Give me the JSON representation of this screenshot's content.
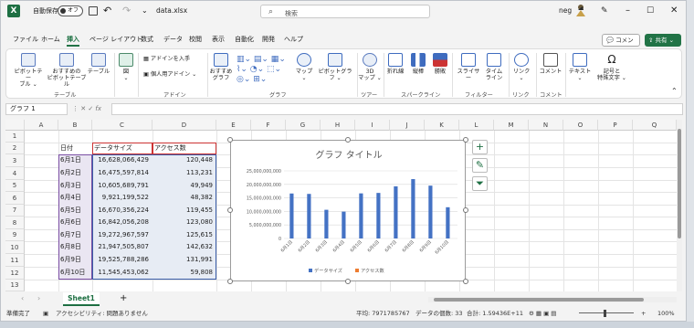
{
  "titlebar": {
    "autosave_label": "自動保存",
    "autosave_state": "オフ",
    "doc_title": "data.xlsx",
    "qat_more": "⌄",
    "search_placeholder": "検索",
    "user_name": "neg",
    "accent_color": "#217346"
  },
  "tabs": [
    "ファイル",
    "ホーム",
    "挿入",
    "ページ レイアウト",
    "数式",
    "データ",
    "校閲",
    "表示",
    "自動化",
    "開発",
    "ヘルプ"
  ],
  "active_tab": "挿入",
  "comment_button": "コメント",
  "share_button": "共有",
  "ribbon": {
    "pivot_table": "ピボットテー\nブル ⌄",
    "recommended_pivot": "おすすめの\nピボットテーブル",
    "table": "テーブル",
    "group_table": "テーブル",
    "figure": "図",
    "figure_more": "⌄",
    "get_addins": "アドインを入手",
    "my_addins": "個人用アドイン",
    "group_addins": "アドイン",
    "recommended_charts": "おすすめ\nグラフ",
    "map": "マップ",
    "pivot_chart": "ピボットグラフ",
    "group_chart": "グラフ",
    "map3d": "3D\nマップ ⌄",
    "group_tour": "ツアー",
    "line": "折れ線",
    "column": "縦棒",
    "winloss": "勝敗",
    "group_sparkline": "スパークライン",
    "slicer": "スライサー",
    "timeline": "タイム\nライン",
    "group_filter": "フィルター",
    "link": "リンク",
    "group_link": "リンク",
    "comment": "コメント",
    "group_comment": "コメント",
    "text": "テキスト",
    "symbol": "記号と\n特殊文字 ⌄"
  },
  "formula": {
    "name_box": "グラフ 1",
    "fx": "fx",
    "value": ""
  },
  "columns": [
    "A",
    "B",
    "C",
    "D",
    "E",
    "F",
    "G",
    "H",
    "I",
    "J",
    "K",
    "L",
    "M",
    "N",
    "O",
    "P",
    "Q"
  ],
  "rows": [
    "1",
    "2",
    "3",
    "4",
    "5",
    "6",
    "7",
    "8",
    "9",
    "10",
    "11",
    "12",
    "13"
  ],
  "table": {
    "header": [
      "日付",
      "データサイズ",
      "アクセス数"
    ],
    "rows": [
      [
        "6月1日",
        "16,628,066,429",
        "120,448"
      ],
      [
        "6月2日",
        "16,475,597,814",
        "113,231"
      ],
      [
        "6月3日",
        "10,605,689,791",
        "49,949"
      ],
      [
        "6月4日",
        "9,921,199,522",
        "48,382"
      ],
      [
        "6月5日",
        "16,670,356,224",
        "119,455"
      ],
      [
        "6月6日",
        "16,842,056,208",
        "123,080"
      ],
      [
        "6月7日",
        "19,272,967,597",
        "125,615"
      ],
      [
        "6月8日",
        "21,947,505,807",
        "142,632"
      ],
      [
        "6月9日",
        "19,525,788,286",
        "131,991"
      ],
      [
        "6月10日",
        "11,545,453,062",
        "59,808"
      ]
    ]
  },
  "chart_data": {
    "type": "bar",
    "title": "グラフ タイトル",
    "categories": [
      "6月1日",
      "6月2日",
      "6月3日",
      "6月4日",
      "6月5日",
      "6月6日",
      "6月7日",
      "6月8日",
      "6月9日",
      "6月10日"
    ],
    "series": [
      {
        "name": "データサイズ",
        "color": "#4472c4",
        "values": [
          16628066429,
          16475597814,
          10605689791,
          9921199522,
          16670356224,
          16842056208,
          19272967597,
          21947505807,
          19525788286,
          11545453062
        ]
      },
      {
        "name": "アクセス数",
        "color": "#ed7d31",
        "values": [
          120448,
          113231,
          49949,
          48382,
          119455,
          123080,
          125615,
          142632,
          131991,
          59808
        ]
      }
    ],
    "ylim": [
      0,
      25000000000
    ],
    "yticks": [
      "25,000,000,000",
      "20,000,000,000",
      "15,000,000,000",
      "10,000,000,000",
      "5,000,000,000",
      "0"
    ],
    "legend": "bottom"
  },
  "sheet": {
    "name": "Sheet1",
    "add": "+"
  },
  "status": {
    "ready": "準備完了",
    "accessibility": "アクセシビリティ: 問題ありません",
    "average": "平均: 7971785767",
    "count": "データの個数: 33",
    "sum": "合計: 1.59436E+11",
    "zoom": "100%"
  }
}
